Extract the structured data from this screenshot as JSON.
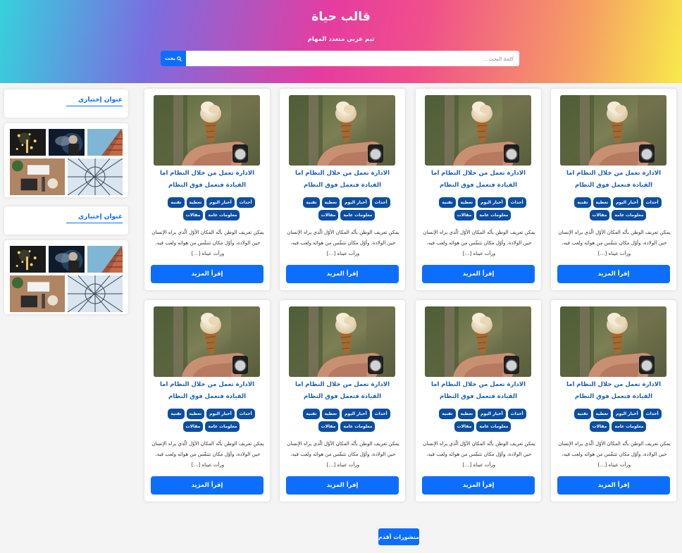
{
  "header": {
    "title": "قالب حياة",
    "description": "ثيم عربي متعدد المهام"
  },
  "search": {
    "placeholder": "كلمة البحث...",
    "button_label": "بحث",
    "button_icon": "search-icon"
  },
  "sidebar": {
    "widgets": [
      {
        "title": "عنوان إختياري"
      },
      {
        "gallery": [
          "sparklers",
          "man-in-smoke",
          "skyscraper",
          "desk-flatlay",
          "glass-roof"
        ]
      },
      {
        "title": "عنوان إختياري"
      },
      {
        "gallery": [
          "sparklers",
          "man-in-smoke",
          "skyscraper",
          "desk-flatlay",
          "glass-roof"
        ]
      }
    ]
  },
  "posts": [
    {
      "title": "الادارة تعمل من خلال النظام اما القيادة فتعمل فوق النظام",
      "tags": [
        "أحداث",
        "أخبار اليوم",
        "تغطية",
        "تقنية",
        "معلومات عامة",
        "مقالات"
      ],
      "excerpt": "يمكن تعريف الوطن بأنّه المكان الأوّل الّذي يراه الإنسان حين الولادة، وأوّل مكان تتنفّس من هوائه ولعب فيه، ورأت عيناه […]",
      "button": "إقرأ المزيد"
    },
    {
      "title": "الادارة تعمل من خلال النظام اما القيادة فتعمل فوق النظام",
      "tags": [
        "أحداث",
        "أخبار اليوم",
        "تغطية",
        "تقنية",
        "معلومات عامة",
        "مقالات"
      ],
      "excerpt": "يمكن تعريف الوطن بأنّه المكان الأوّل الّذي يراه الإنسان حين الولادة، وأوّل مكان تتنفّس من هوائه ولعب فيه، ورأت عيناه […]",
      "button": "إقرأ المزيد"
    },
    {
      "title": "الادارة تعمل من خلال النظام اما القيادة فتعمل فوق النظام",
      "tags": [
        "أحداث",
        "أخبار اليوم",
        "تغطية",
        "تقنية",
        "معلومات عامة",
        "مقالات"
      ],
      "excerpt": "يمكن تعريف الوطن بأنّه المكان الأوّل الّذي يراه الإنسان حين الولادة، وأوّل مكان تتنفّس من هوائه ولعب فيه، ورأت عيناه […]",
      "button": "إقرأ المزيد"
    },
    {
      "title": "الادارة تعمل من خلال النظام اما القيادة فتعمل فوق النظام",
      "tags": [
        "أحداث",
        "أخبار اليوم",
        "تغطية",
        "تقنية",
        "معلومات عامة",
        "مقالات"
      ],
      "excerpt": "يمكن تعريف الوطن بأنّه المكان الأوّل الّذي يراه الإنسان حين الولادة، وأوّل مكان تتنفّس من هوائه ولعب فيه، ورأت عيناه […]",
      "button": "إقرأ المزيد"
    },
    {
      "title": "الادارة تعمل من خلال النظام اما القيادة فتعمل فوق النظام",
      "tags": [
        "أحداث",
        "أخبار اليوم",
        "تغطية",
        "تقنية",
        "معلومات عامة",
        "مقالات"
      ],
      "excerpt": "يمكن تعريف الوطن بأنّه المكان الأوّل الّذي يراه الإنسان حين الولادة، وأوّل مكان تتنفّس من هوائه ولعب فيه، ورأت عيناه […]",
      "button": "إقرأ المزيد"
    },
    {
      "title": "الادارة تعمل من خلال النظام اما القيادة فتعمل فوق النظام",
      "tags": [
        "أحداث",
        "أخبار اليوم",
        "تغطية",
        "تقنية",
        "معلومات عامة",
        "مقالات"
      ],
      "excerpt": "يمكن تعريف الوطن بأنّه المكان الأوّل الّذي يراه الإنسان حين الولادة، وأوّل مكان تتنفّس من هوائه ولعب فيه، ورأت عيناه […]",
      "button": "إقرأ المزيد"
    },
    {
      "title": "الادارة تعمل من خلال النظام اما القيادة فتعمل فوق النظام",
      "tags": [
        "أحداث",
        "أخبار اليوم",
        "تغطية",
        "تقنية",
        "معلومات عامة",
        "مقالات"
      ],
      "excerpt": "يمكن تعريف الوطن بأنّه المكان الأوّل الّذي يراه الإنسان حين الولادة، وأوّل مكان تتنفّس من هوائه ولعب فيه، ورأت عيناه […]",
      "button": "إقرأ المزيد"
    },
    {
      "title": "الادارة تعمل من خلال النظام اما القيادة فتعمل فوق النظام",
      "tags": [
        "أحداث",
        "أخبار اليوم",
        "تغطية",
        "تقنية",
        "معلومات عامة",
        "مقالات"
      ],
      "excerpt": "يمكن تعريف الوطن بأنّه المكان الأوّل الّذي يراه الإنسان حين الولادة، وأوّل مكان تتنفّس من هوائه ولعب فيه، ورأت عيناه […]",
      "button": "إقرأ المزيد"
    }
  ],
  "post_image": "ice-cream-cone-in-hand",
  "pagination": {
    "older_label": "منشورات أقدم"
  },
  "colors": {
    "accent": "#0d6efd",
    "tag": "#0b4ea2",
    "title": "#1a5fb4"
  }
}
